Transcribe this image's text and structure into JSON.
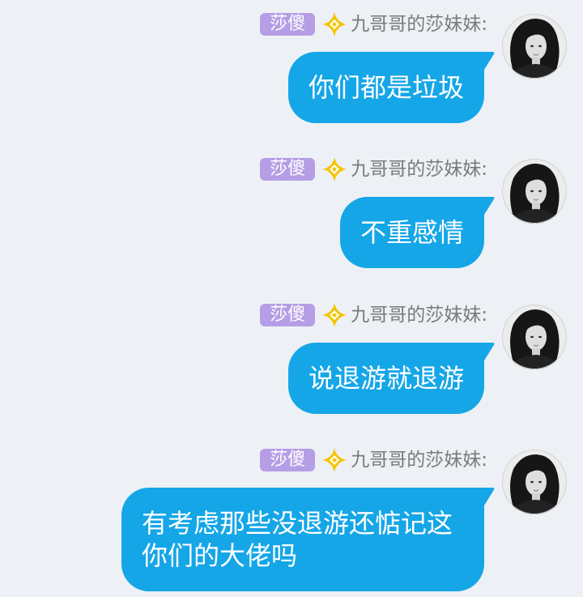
{
  "messages": [
    {
      "badge": "莎傻",
      "sender": "九哥哥的莎妹妹:",
      "text": "你们都是垃圾"
    },
    {
      "badge": "莎傻",
      "sender": "九哥哥的莎妹妹:",
      "text": "不重感情"
    },
    {
      "badge": "莎傻",
      "sender": "九哥哥的莎妹妹:",
      "text": "说退游就退游"
    },
    {
      "badge": "莎傻",
      "sender": "九哥哥的莎妹妹:",
      "text": "有考虑那些没退游还惦记这你们的大佬吗"
    }
  ],
  "icons": {
    "title_icon": "diamond-star-icon",
    "avatar": "avatar"
  },
  "colors": {
    "background": "#edf1f5",
    "bubble": "#15a6e8",
    "bubble_text": "#ffffff",
    "badge": "#b59ee6",
    "badge_text": "#ffffff",
    "diamond": "#f5c400",
    "sender_text": "#7a7a7a"
  }
}
